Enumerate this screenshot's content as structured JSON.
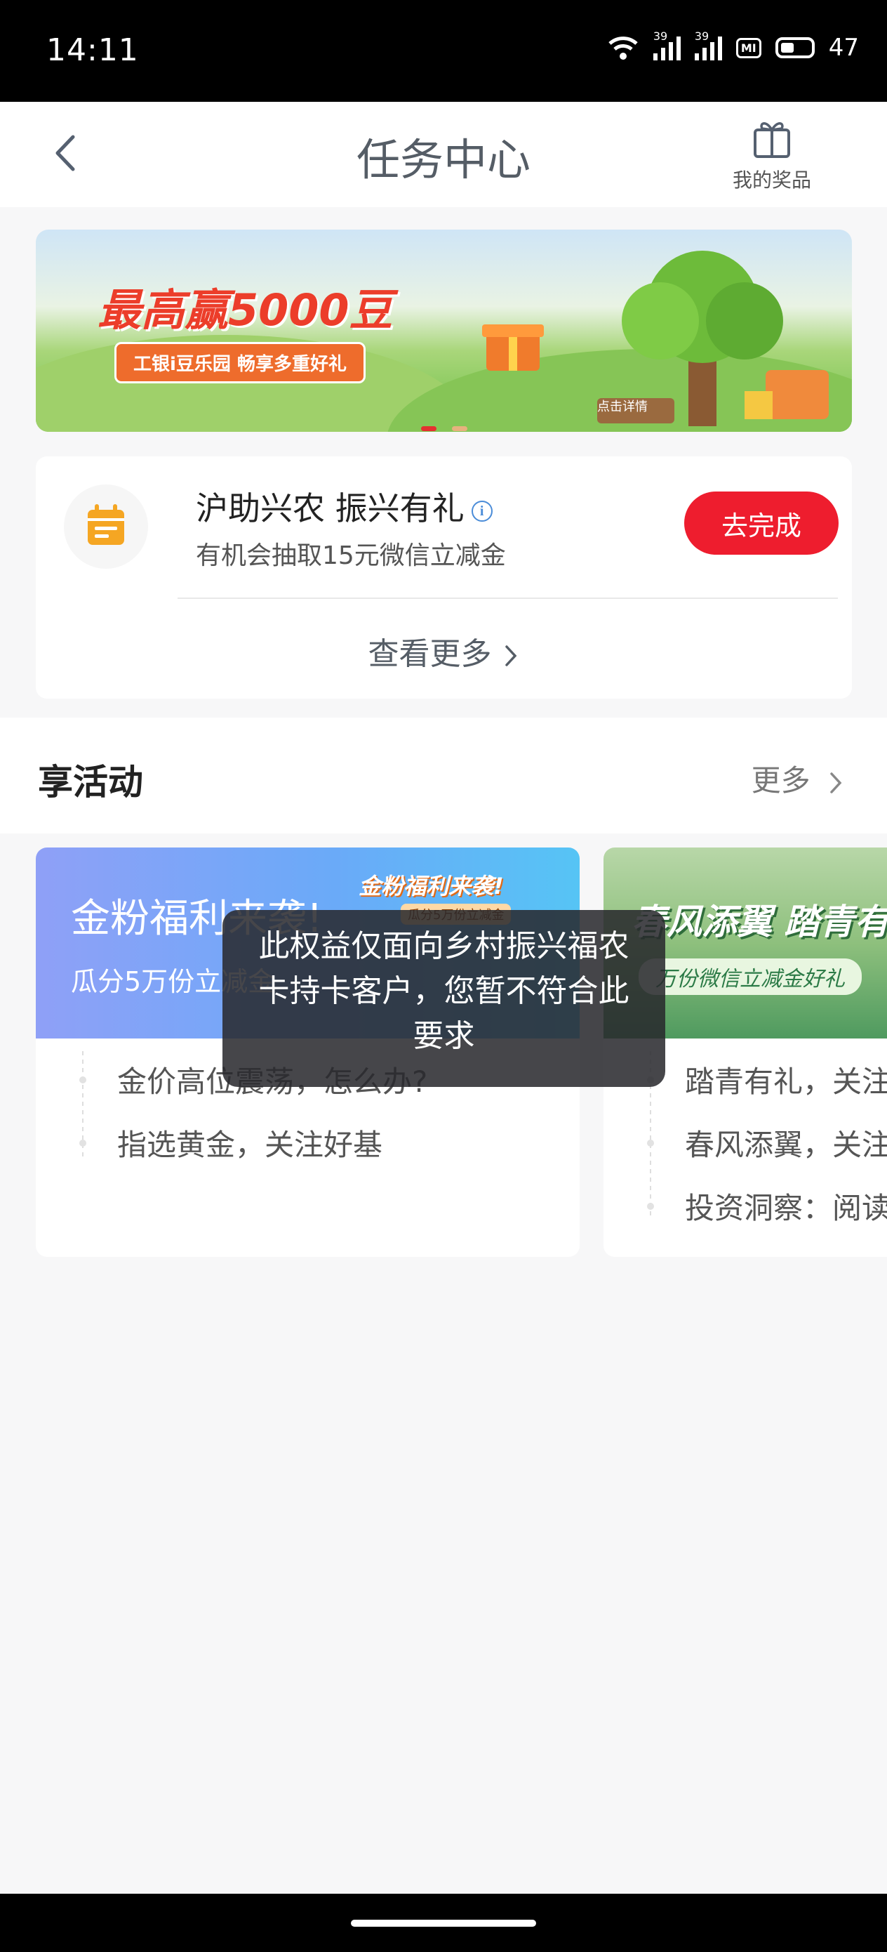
{
  "status_bar": {
    "time": "14:11",
    "signal1_label": "39",
    "signal2_label": "39",
    "mi_badge": "MI",
    "battery_level": "47"
  },
  "header": {
    "title": "任务中心",
    "prize_label": "我的奖品",
    "back_icon": "chevron-left-icon",
    "prize_icon": "gift-icon"
  },
  "banner": {
    "title": "最高赢5000豆",
    "subtitle": "工银i豆乐园 畅享多重好礼",
    "sign_text": "点击详情",
    "active_slide": 1,
    "slide_count": 2
  },
  "task": {
    "icon": "calendar-icon",
    "title": "沪助兴农 振兴有礼",
    "description": "有机会抽取15元微信立减金",
    "button_label": "去完成",
    "more_label": "查看更多"
  },
  "section": {
    "title": "享活动",
    "more_label": "更多"
  },
  "activities": [
    {
      "banner_title": "金粉福利来袭!",
      "banner_subtitle": "瓜分5万份立减金",
      "badge_text": "金粉福利来袭!",
      "badge_sub": "瓜分5万份立减金",
      "items": [
        "金价高位震荡，怎么办?",
        "指选黄金，关注好基"
      ]
    },
    {
      "banner_title": "春风添翼 踏青有",
      "banner_subtitle": "万份微信立减金好礼",
      "items": [
        "踏青有礼，关注",
        "春风添翼，关注",
        "投资洞察：阅读"
      ]
    }
  ],
  "toast": {
    "message": "此权益仅面向乡村振兴福农卡持卡客户，您暂不符合此要求"
  },
  "colors": {
    "accent_red": "#ee1d2e",
    "task_icon_orange": "#f5a623",
    "page_bg": "#f7f7f8"
  }
}
